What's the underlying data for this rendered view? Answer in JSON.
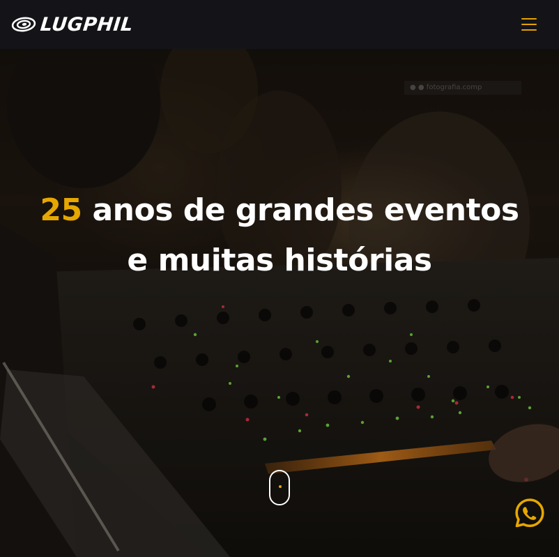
{
  "header": {
    "logo_text": "LUGPHIL",
    "logo_icon": "lugphil-logo-icon",
    "menu_icon": "hamburger-menu-icon"
  },
  "hero": {
    "headline_accent": "25",
    "headline_rest": " anos de grandes eventos e muitas histórias",
    "scroll_indicator_icon": "mouse-scroll-icon",
    "whatsapp_icon": "whatsapp-icon",
    "photo_credit": "● ● fotografia.comp"
  },
  "colors": {
    "accent": "#e6a700",
    "header_bg": "#141418",
    "text": "#ffffff"
  }
}
